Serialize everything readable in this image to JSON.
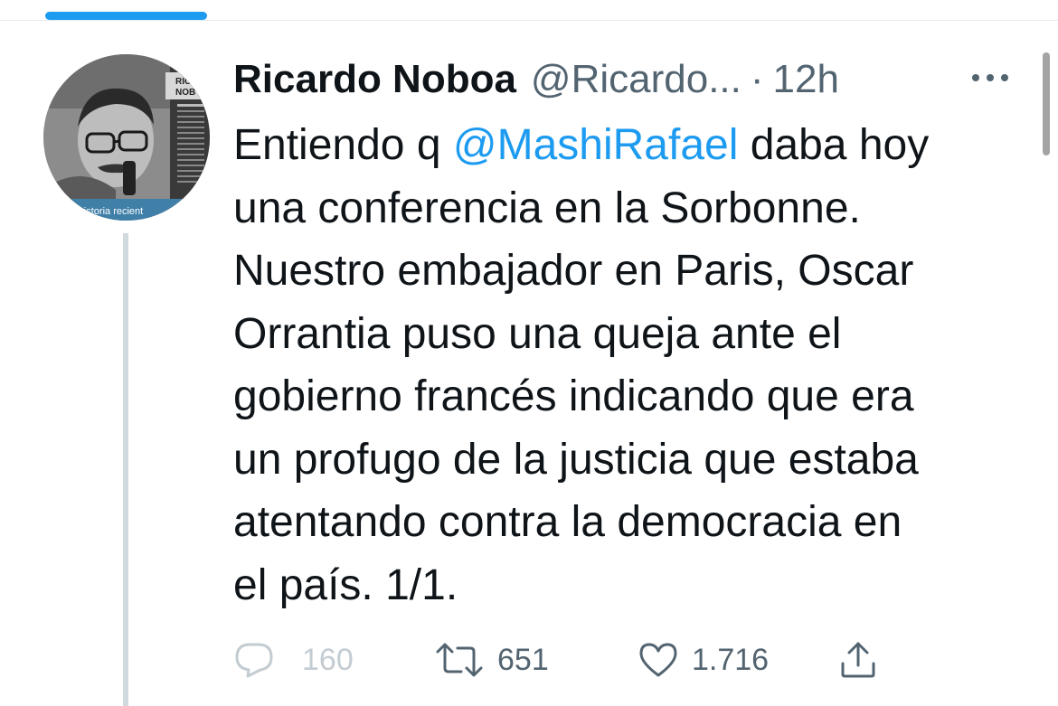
{
  "tweet": {
    "author_name": "Ricardo Noboa",
    "author_handle": "@Ricardo...",
    "separator": "·",
    "timestamp": "12h",
    "text_lines": [
      [
        "Entiendo q ",
        "@MashiRafael",
        " daba hoy"
      ],
      "una conferencia en la Sorbonne.",
      "Nuestro embajador en Paris, Oscar",
      "Orrantia puso una queja ante el",
      "gobierno francés indicando que era",
      "un profugo de la justicia que estaba",
      "atentando contra la democracia en",
      "el país. 1/1."
    ],
    "avatar_text": {
      "heading_top": "RIC",
      "heading_bottom": "NOB",
      "caption": "eron la historia recient"
    }
  },
  "actions": {
    "reply_count": "160",
    "retweet_count": "651",
    "like_count": "1.716"
  },
  "icons": {
    "more": "more-horizontal-icon",
    "reply": "reply-bubble-icon",
    "retweet": "retweet-icon",
    "like": "heart-icon",
    "share": "share-icon"
  },
  "colors": {
    "accent": "#1d9bf0",
    "text_primary": "#0f1419",
    "text_secondary": "#536471",
    "thread_line": "#cfd9de"
  }
}
